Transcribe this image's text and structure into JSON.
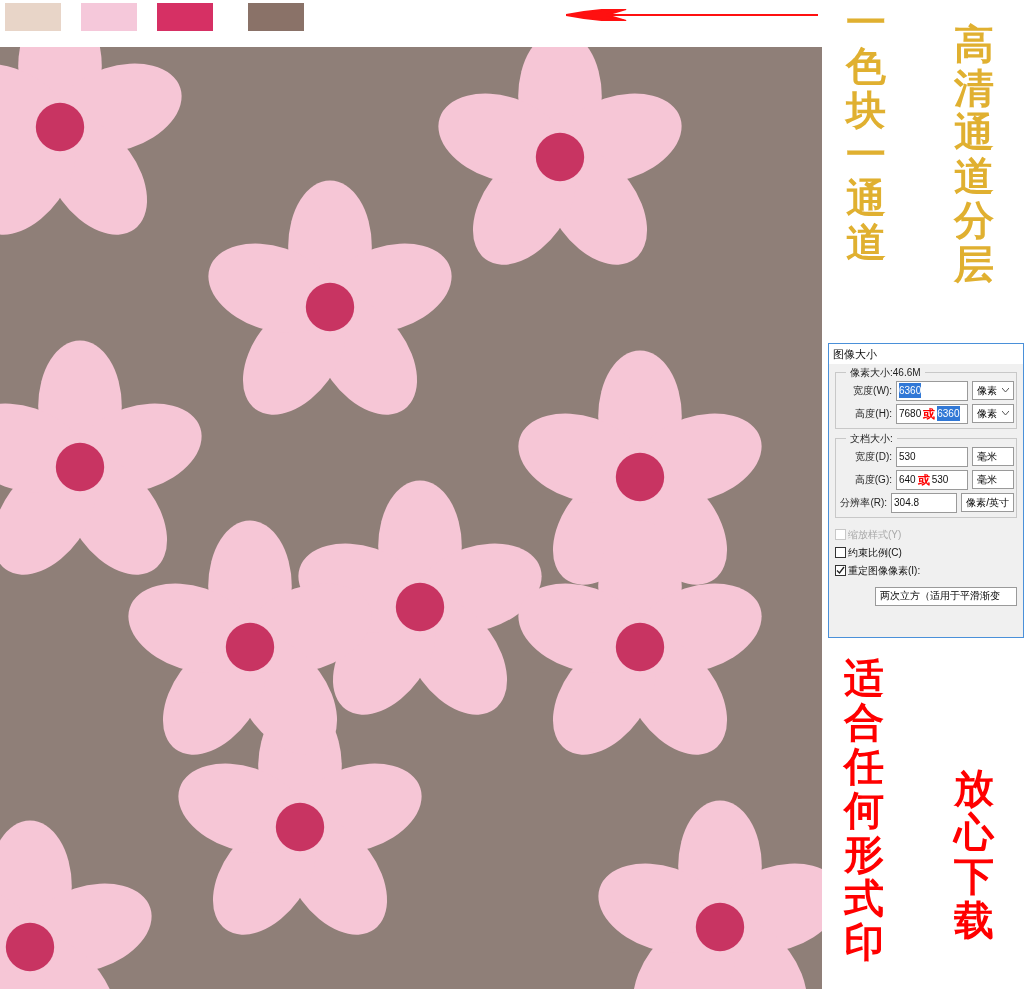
{
  "swatches": [
    {
      "color": "#e8d5c8"
    },
    {
      "color": "#f5c8da"
    },
    {
      "color": "#d63064"
    },
    {
      "color": "#8a7268"
    }
  ],
  "captions_top": [
    {
      "text": "一色块一通道",
      "color": "#e0b030"
    },
    {
      "text": "高清通道分层",
      "color": "#e0b030"
    }
  ],
  "dialog": {
    "title": "图像大小",
    "groups": [
      {
        "title": "像素大小:46.6M",
        "fields": [
          {
            "label": "宽度(W):",
            "value": "6360",
            "value_highlighted": true,
            "unit": "像素",
            "dropdown": true
          },
          {
            "label": "高度(H):",
            "value": "7680",
            "note": "或",
            "alt_value": "6360",
            "alt_highlighted": true,
            "unit": "像素",
            "dropdown": true
          }
        ]
      },
      {
        "title": "文档大小:",
        "fields": [
          {
            "label": "宽度(D):",
            "value": "530",
            "value_highlighted": false,
            "unit": "毫米",
            "dropdown": false
          },
          {
            "label": "高度(G):",
            "value": "640",
            "note": "或",
            "alt_value": "530",
            "alt_highlighted": false,
            "unit": "毫米",
            "dropdown": false
          },
          {
            "label": "分辨率(R):",
            "value": "304.8",
            "value_highlighted": false,
            "unit": "像素/英寸",
            "dropdown": false
          }
        ]
      }
    ],
    "checkboxes": [
      {
        "label": "缩放样式(Y)",
        "checked": false,
        "disabled": true
      },
      {
        "label": "约束比例(C)",
        "checked": false,
        "disabled": false
      },
      {
        "label": "重定图像像素(I):",
        "checked": true,
        "disabled": false
      }
    ],
    "method": "两次立方（适用于平滑渐变"
  },
  "captions_bottom": [
    {
      "text": "适合任何形式印",
      "color": "#ff0000"
    },
    {
      "text": "放心下载",
      "color": "#ff0000"
    }
  ]
}
